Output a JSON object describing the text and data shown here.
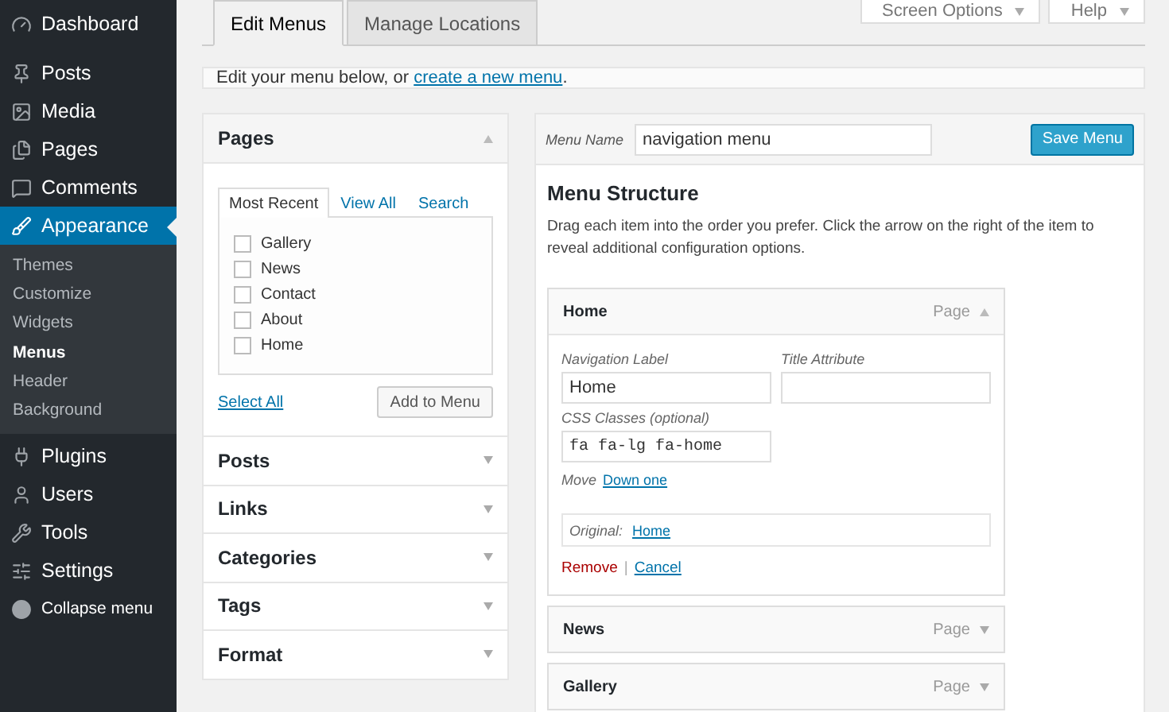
{
  "sidebar": {
    "items": [
      {
        "label": "Dashboard",
        "selected": false
      },
      {
        "label": "Posts",
        "selected": false
      },
      {
        "label": "Media",
        "selected": false
      },
      {
        "label": "Pages",
        "selected": false
      },
      {
        "label": "Comments",
        "selected": false
      },
      {
        "label": "Appearance",
        "selected": true,
        "children": [
          {
            "label": "Themes",
            "selected": false
          },
          {
            "label": "Customize",
            "selected": false
          },
          {
            "label": "Widgets",
            "selected": false
          },
          {
            "label": "Menus",
            "selected": true
          },
          {
            "label": "Header",
            "selected": false
          },
          {
            "label": "Background",
            "selected": false
          }
        ]
      },
      {
        "label": "Plugins",
        "selected": false
      },
      {
        "label": "Users",
        "selected": false
      },
      {
        "label": "Tools",
        "selected": false
      },
      {
        "label": "Settings",
        "selected": false
      },
      {
        "label": "Collapse menu",
        "selected": false
      }
    ]
  },
  "top_buttons": [
    "Screen Options",
    "Help"
  ],
  "tabs": [
    {
      "label": "Edit Menus",
      "selected": true
    },
    {
      "label": "Manage Locations",
      "selected": false
    }
  ],
  "notice": {
    "text": "Edit your menu below, or ",
    "link": "create a new menu",
    "suffix": "."
  },
  "panels": [
    {
      "title": "Pages",
      "expanded": true,
      "tabs": [
        {
          "label": "Most Recent",
          "selected": true
        },
        {
          "label": "View All",
          "selected": false
        },
        {
          "label": "Search",
          "selected": false
        }
      ],
      "items": [
        {
          "label": "Gallery",
          "checked": false
        },
        {
          "label": "News",
          "checked": false
        },
        {
          "label": "Contact",
          "checked": false
        },
        {
          "label": "About",
          "checked": false
        },
        {
          "label": "Home",
          "checked": false
        }
      ],
      "select_all": "Select All",
      "add_button": "Add to Menu"
    },
    {
      "title": "Posts",
      "expanded": false
    },
    {
      "title": "Links",
      "expanded": false
    },
    {
      "title": "Categories",
      "expanded": false
    },
    {
      "title": "Tags",
      "expanded": false
    },
    {
      "title": "Format",
      "expanded": false
    }
  ],
  "menu_name": {
    "label": "Menu Name",
    "value": "navigation menu"
  },
  "save_button": "Save Menu",
  "structure": {
    "heading": "Menu Structure",
    "description": "Drag each item into the order you prefer. Click the arrow on the right of the item to reveal additional configuration options."
  },
  "menu_items": [
    {
      "title": "Home",
      "type": "Page",
      "expanded": true,
      "navigation_label": {
        "label": "Navigation Label",
        "value": "Home"
      },
      "title_attribute": {
        "label": "Title Attribute"
      },
      "css_classes": {
        "label": "CSS Classes (optional)",
        "value": "fa fa-lg fa-home"
      },
      "move": {
        "label": "Move",
        "link": "Down one"
      },
      "original": {
        "label": "Original:",
        "link": "Home"
      },
      "actions": {
        "remove": "Remove",
        "separator": "|",
        "cancel": "Cancel"
      }
    },
    {
      "title": "News",
      "type": "Page",
      "expanded": false
    },
    {
      "title": "Gallery",
      "type": "Page",
      "expanded": false
    }
  ]
}
